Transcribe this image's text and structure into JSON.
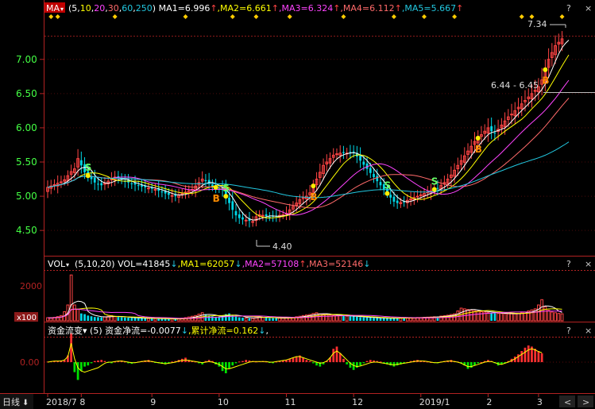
{
  "colors": {
    "up": "#ff4444",
    "down": "#00d8e8",
    "ma1": "#ffffff",
    "ma2": "#ffff00",
    "ma3": "#ff44ff",
    "ma4": "#ff6a6a",
    "ma5": "#22c8e0",
    "axis": "#b22222",
    "label_green": "#44ff44",
    "buy": "#ff8c00",
    "sell": "#66ff66",
    "marker": "#ffcc00",
    "hist_pos": "#ff3030",
    "hist_neg": "#00e000",
    "flow_line": "#ffff00"
  },
  "price_panel": {
    "indicator_btn": "MA",
    "periods_prefix": "(",
    "periods": [
      "5",
      "10",
      "20",
      "30",
      "60",
      "250"
    ],
    "periods_suffix": ")",
    "ma_labels": [
      {
        "label": "MA1=6.996",
        "arrow": "↑",
        "color_key": "ma1"
      },
      {
        "label": ",MA2=6.661",
        "arrow": "↑",
        "color_key": "ma2"
      },
      {
        "label": ",MA3=6.324",
        "arrow": "↑",
        "color_key": "ma3"
      },
      {
        "label": ",MA4=6.112",
        "arrow": "↑",
        "color_key": "ma4"
      },
      {
        "label": ",MA5=5.667",
        "arrow": "↑",
        "color_key": "ma5"
      }
    ],
    "high_label": "7.34",
    "low_label": "4.40",
    "range_label": "6.44 - 6.45",
    "corner_buttons": [
      "?",
      "×"
    ]
  },
  "volume_panel": {
    "indicator_btn": "VOL",
    "periods_text": "(5,10,20)",
    "vol_label": "VOL=41845",
    "vol_arrow": "↓",
    "ma_labels": [
      {
        "label": ",MA1=62057",
        "arrow": "↓",
        "color_key": "ma2"
      },
      {
        "label": ",MA2=57108",
        "arrow": "↑",
        "color_key": "ma3"
      },
      {
        "label": ",MA3=52146",
        "arrow": "↓",
        "color_key": "ma4"
      }
    ],
    "unit": "x100",
    "corner_buttons": [
      "?",
      "×"
    ]
  },
  "flow_panel": {
    "indicator_btn": "资金流变",
    "period": "(5)",
    "net_label": "资金净流=-0.0077",
    "net_arrow": "↓",
    "cum_label": ",累计净流=0.162",
    "cum_arrow": "↓",
    "trail": ",",
    "corner_buttons": [
      "?",
      "×"
    ]
  },
  "footer": {
    "period_btn": "日线",
    "period_arrow": "🡇",
    "arrows": [
      "<",
      ">"
    ]
  },
  "chart_data": {
    "type": "candlestick",
    "title": "",
    "price_axis": {
      "ticks": [
        "7.00",
        "6.50",
        "6.00",
        "5.50",
        "5.00",
        "4.50"
      ],
      "ylim": [
        4.2,
        7.45
      ]
    },
    "volume_axis": {
      "ticks": [
        "2000"
      ],
      "ylim": [
        0,
        2700
      ]
    },
    "flow_axis": {
      "ticks": [
        "0.00"
      ]
    },
    "x_labels": [
      "2018/7",
      "8",
      "9",
      "10",
      "11",
      "12",
      "2019/1",
      "2",
      "3"
    ],
    "x_label_index": [
      0,
      10,
      31,
      51,
      71,
      91,
      111,
      131,
      146
    ],
    "n_bars": 156,
    "close": [
      5.13,
      5.15,
      5.17,
      5.19,
      5.21,
      5.24,
      5.3,
      5.36,
      5.4,
      5.55,
      5.45,
      5.35,
      5.3,
      5.25,
      5.2,
      5.18,
      5.16,
      5.19,
      5.22,
      5.25,
      5.28,
      5.26,
      5.24,
      5.22,
      5.2,
      5.18,
      5.17,
      5.15,
      5.14,
      5.13,
      5.12,
      5.11,
      5.1,
      5.08,
      5.06,
      5.04,
      5.02,
      5.01,
      5.0,
      5.02,
      5.04,
      5.06,
      5.08,
      5.1,
      5.15,
      5.2,
      5.25,
      5.22,
      5.18,
      5.15,
      5.13,
      5.11,
      5.09,
      5.0,
      4.9,
      4.8,
      4.72,
      4.68,
      4.66,
      4.65,
      4.64,
      4.63,
      4.7,
      4.73,
      4.72,
      4.71,
      4.7,
      4.7,
      4.71,
      4.72,
      4.73,
      4.75,
      4.8,
      4.85,
      4.9,
      4.95,
      4.98,
      5.0,
      5.05,
      5.15,
      5.25,
      5.35,
      5.45,
      5.5,
      5.55,
      5.6,
      5.62,
      5.63,
      5.63,
      5.63,
      5.64,
      5.65,
      5.58,
      5.52,
      5.46,
      5.4,
      5.34,
      5.28,
      5.22,
      5.16,
      5.1,
      5.04,
      4.98,
      4.92,
      4.9,
      4.91,
      4.92,
      4.94,
      4.96,
      4.98,
      5.0,
      5.02,
      5.04,
      5.06,
      5.08,
      5.1,
      5.12,
      5.16,
      5.2,
      5.25,
      5.31,
      5.38,
      5.45,
      5.52,
      5.59,
      5.66,
      5.73,
      5.8,
      5.85,
      5.9,
      5.95,
      6.0,
      5.95,
      5.92,
      5.98,
      6.04,
      6.1,
      6.16,
      6.2,
      6.25,
      6.3,
      6.35,
      6.4,
      6.45,
      6.5,
      6.55,
      6.6,
      6.7,
      6.85,
      7.0,
      7.1,
      7.2,
      7.25,
      7.3,
      7.32,
      7.34
    ],
    "open_offset": [
      0.06,
      -0.05,
      0.04,
      -0.07,
      0.05,
      0.03,
      -0.04,
      0.06,
      -0.05,
      0.09,
      -0.08,
      0.06,
      0.05,
      -0.04,
      0.07,
      -0.06,
      0.04,
      0.05,
      -0.03,
      0.06,
      -0.05,
      0.04,
      0.03,
      -0.06,
      0.05,
      -0.04,
      0.06,
      -0.03,
      0.04,
      0.05,
      -0.04,
      0.03,
      -0.05,
      0.06,
      -0.04,
      0.05,
      0.03,
      -0.06,
      0.04,
      -0.05,
      0.03,
      0.06,
      -0.04,
      0.05,
      -0.06,
      0.04,
      0.07,
      -0.05,
      0.06,
      -0.04,
      0.05,
      -0.03,
      0.06,
      0.08,
      -0.07,
      0.09,
      -0.06,
      0.05,
      0.04,
      -0.05,
      0.06,
      -0.04,
      0.05,
      0.03,
      -0.04,
      0.05,
      -0.03,
      0.04,
      0.05,
      -0.04,
      0.03,
      0.06,
      -0.05,
      0.04,
      0.06,
      -0.04,
      0.05,
      -0.06,
      0.07,
      -0.05,
      0.06,
      0.08,
      -0.06,
      0.07,
      -0.05,
      0.06,
      0.04,
      -0.07,
      0.05,
      -0.04,
      0.06,
      0.05,
      -0.06,
      0.07,
      -0.05,
      0.06,
      0.04,
      -0.05,
      0.06,
      -0.04,
      0.05,
      0.03,
      -0.06,
      0.04,
      0.05,
      -0.03,
      0.04,
      -0.05,
      0.06,
      -0.04,
      0.05,
      0.03,
      -0.04,
      0.05,
      -0.06,
      0.04,
      0.07,
      -0.05,
      0.06,
      -0.04,
      0.08,
      -0.06,
      0.07,
      0.05,
      -0.08,
      0.07,
      -0.06,
      0.09,
      -0.07,
      0.08,
      0.06,
      -0.09,
      0.08,
      -0.07,
      0.09,
      0.06,
      -0.08,
      0.07,
      0.1,
      -0.08,
      0.09,
      -0.07,
      0.1,
      0.08,
      -0.09,
      0.1,
      -0.08,
      0.12,
      -0.1,
      0.11,
      0.09,
      -0.1,
      0.08,
      -0.07
    ],
    "volume": [
      180,
      160,
      200,
      240,
      300,
      520,
      900,
      2600,
      900,
      650,
      420,
      380,
      300,
      260,
      220,
      210,
      200,
      230,
      260,
      300,
      250,
      220,
      210,
      190,
      180,
      170,
      160,
      150,
      150,
      140,
      140,
      130,
      130,
      120,
      120,
      110,
      110,
      110,
      100,
      120,
      150,
      180,
      220,
      260,
      300,
      380,
      460,
      380,
      300,
      260,
      220,
      200,
      300,
      380,
      420,
      300,
      240,
      200,
      180,
      160,
      150,
      150,
      230,
      260,
      200,
      180,
      160,
      150,
      150,
      160,
      160,
      170,
      180,
      200,
      230,
      260,
      300,
      330,
      360,
      420,
      460,
      400,
      380,
      360,
      330,
      310,
      300,
      290,
      280,
      270,
      260,
      250,
      230,
      210,
      200,
      190,
      180,
      170,
      160,
      150,
      150,
      150,
      150,
      150,
      160,
      160,
      170,
      170,
      180,
      180,
      190,
      190,
      200,
      210,
      220,
      230,
      250,
      270,
      290,
      320,
      360,
      400,
      560,
      720,
      680,
      640,
      600,
      580,
      560,
      520,
      500,
      480,
      460,
      440,
      420,
      420,
      410,
      400,
      400,
      400,
      420,
      450,
      500,
      560,
      620,
      680,
      900,
      1200,
      800,
      600,
      500,
      460,
      420,
      400
    ],
    "flow": [
      0.05,
      0.08,
      0.1,
      0.12,
      0.15,
      0.2,
      0.6,
      2.6,
      -0.9,
      -1.6,
      -0.8,
      -0.4,
      -0.3,
      -0.1,
      0.1,
      0.15,
      0.2,
      0.1,
      -0.05,
      -0.1,
      0.05,
      0.1,
      0.15,
      0.05,
      -0.1,
      -0.15,
      -0.05,
      0.05,
      0.1,
      0.15,
      0.2,
      0.1,
      -0.05,
      -0.1,
      -0.15,
      -0.2,
      -0.1,
      0.05,
      0.1,
      0.2,
      0.3,
      0.4,
      0.2,
      0.1,
      0.05,
      -0.1,
      -0.2,
      0.1,
      0.2,
      0.1,
      -0.2,
      -0.4,
      -0.8,
      -1.0,
      -0.6,
      -0.3,
      -0.1,
      0.05,
      0.1,
      0.2,
      0.15,
      0.1,
      0.05,
      0.08,
      0.1,
      0.05,
      -0.05,
      -0.1,
      0.05,
      0.1,
      0.15,
      0.2,
      0.3,
      0.4,
      0.5,
      0.6,
      0.4,
      0.2,
      0.1,
      -0.1,
      -0.3,
      -0.4,
      -0.2,
      0.1,
      0.4,
      1.2,
      1.4,
      0.8,
      0.3,
      -0.2,
      -0.5,
      -0.7,
      -0.5,
      -0.3,
      -0.1,
      0.1,
      0.2,
      0.15,
      0.1,
      0.05,
      -0.1,
      -0.2,
      -0.3,
      -0.4,
      -0.3,
      -0.2,
      -0.1,
      0.0,
      0.1,
      0.15,
      0.2,
      0.15,
      0.1,
      0.05,
      0.0,
      -0.05,
      -0.1,
      0.05,
      0.1,
      0.15,
      0.2,
      0.1,
      0.05,
      -0.1,
      -0.3,
      -0.6,
      -0.5,
      -0.3,
      -0.1,
      0.0,
      0.1,
      0.2,
      0.1,
      -0.1,
      -0.3,
      -0.2,
      -0.1,
      0.1,
      0.3,
      0.5,
      0.7,
      1.0,
      1.3,
      1.5,
      1.4,
      1.2,
      1.0,
      0.8
    ],
    "cum_flow": [
      0.0,
      0.05,
      0.1,
      0.1,
      0.1,
      0.2,
      0.5,
      1.7,
      0.3,
      -0.5,
      -0.8,
      -0.9,
      -0.8,
      -0.7,
      -0.6,
      -0.5,
      -0.3,
      -0.1,
      0.0,
      0.0,
      0.05,
      0.1,
      0.1,
      0.05,
      0.0,
      -0.05,
      -0.05,
      0.0,
      0.05,
      0.1,
      0.1,
      0.05,
      0.0,
      -0.05,
      -0.1,
      -0.15,
      -0.1,
      -0.05,
      0.0,
      0.1,
      0.15,
      0.2,
      0.15,
      0.1,
      0.05,
      0.0,
      -0.05,
      0.0,
      0.05,
      0.0,
      -0.1,
      -0.2,
      -0.4,
      -0.6,
      -0.6,
      -0.5,
      -0.4,
      -0.3,
      -0.2,
      -0.1,
      0.0,
      0.05,
      0.05,
      0.05,
      0.05,
      0.05,
      0.0,
      0.0,
      0.05,
      0.1,
      0.15,
      0.2,
      0.3,
      0.4,
      0.5,
      0.5,
      0.4,
      0.3,
      0.2,
      0.1,
      0.0,
      -0.1,
      -0.05,
      0.1,
      0.4,
      0.8,
      1.0,
      0.8,
      0.5,
      0.2,
      -0.1,
      -0.3,
      -0.4,
      -0.35,
      -0.25,
      -0.15,
      -0.05,
      0.0,
      0.0,
      -0.05,
      -0.1,
      -0.15,
      -0.2,
      -0.25,
      -0.2,
      -0.15,
      -0.1,
      -0.05,
      0.0,
      0.05,
      0.1,
      0.1,
      0.1,
      0.05,
      0.0,
      -0.05,
      -0.05,
      0.0,
      0.05,
      0.1,
      0.1,
      0.05,
      0.0,
      -0.1,
      -0.25,
      -0.4,
      -0.4,
      -0.3,
      -0.2,
      -0.1,
      0.0,
      0.05,
      0.05,
      -0.05,
      -0.15,
      -0.2,
      -0.1,
      0.0,
      0.15,
      0.3,
      0.5,
      0.7,
      0.9,
      1.1,
      1.2,
      1.1,
      0.95,
      0.85
    ],
    "buy_signals": [
      50,
      79,
      128,
      148
    ],
    "sell_signals": [
      12,
      53,
      101,
      115
    ],
    "top_markers": [
      1,
      3,
      20,
      41,
      55,
      62,
      72,
      88,
      103,
      112,
      121,
      141,
      144,
      153
    ]
  }
}
